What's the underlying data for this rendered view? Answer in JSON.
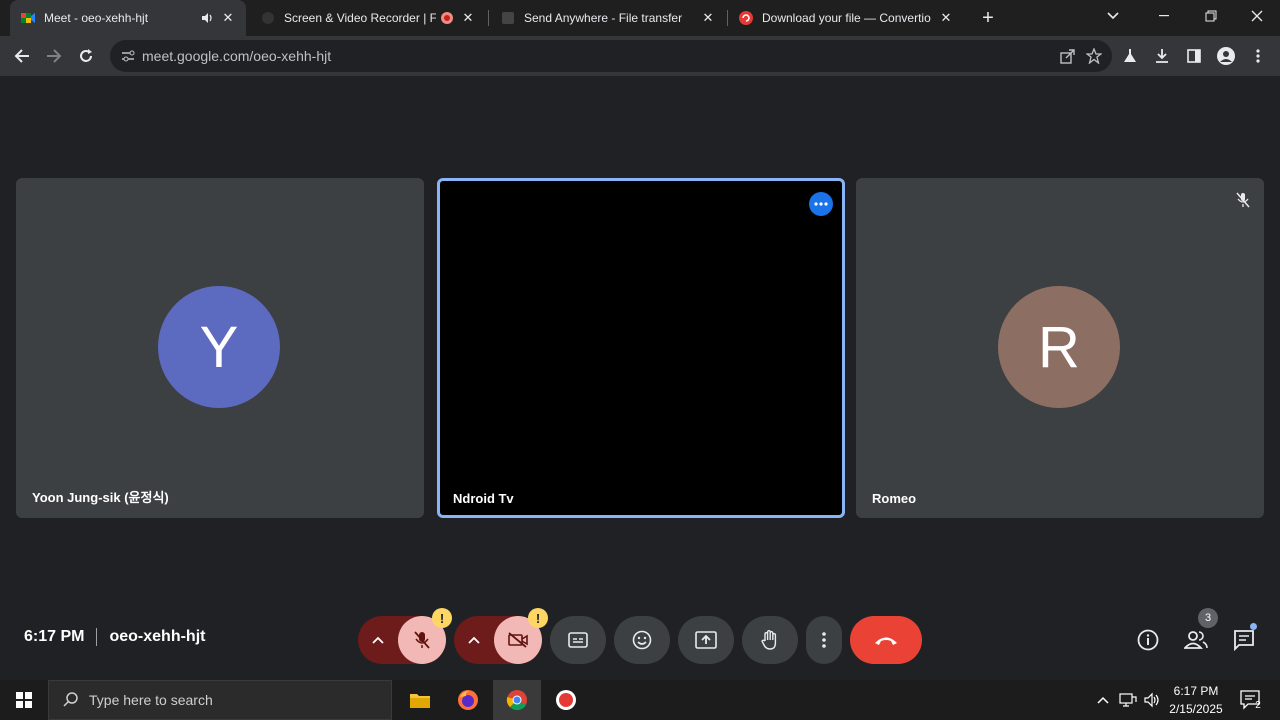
{
  "browser": {
    "tabs": [
      {
        "title": "Meet - oeo-xehh-hjt",
        "active": true
      },
      {
        "title": "Screen & Video Recorder | F",
        "active": false
      },
      {
        "title": "Send Anywhere - File transfer",
        "active": false
      },
      {
        "title": "Download your file — Convertio",
        "active": false
      }
    ],
    "url": "meet.google.com/oeo-xehh-hjt"
  },
  "participants": [
    {
      "name": "Yoon Jung-sik (윤정식)",
      "initial": "Y",
      "avatar_color": "#5c6bc0"
    },
    {
      "name": "Ndroid Tv",
      "initial": "",
      "avatar_color": "#000000"
    },
    {
      "name": "Romeo",
      "initial": "R",
      "avatar_color": "#8d6e63"
    }
  ],
  "meeting": {
    "time": "6:17 PM",
    "code": "oeo-xehh-hjt",
    "participant_count": "3",
    "warning_mark": "!"
  },
  "taskbar": {
    "search_placeholder": "Type here to search",
    "clock_time": "6:17 PM",
    "clock_date": "2/15/2025",
    "notification_count": "2"
  },
  "colors": {
    "accent": "#8ab4f8",
    "end_call": "#ea4335",
    "muted_bg": "#f2b8b5",
    "warning": "#fdd663"
  }
}
